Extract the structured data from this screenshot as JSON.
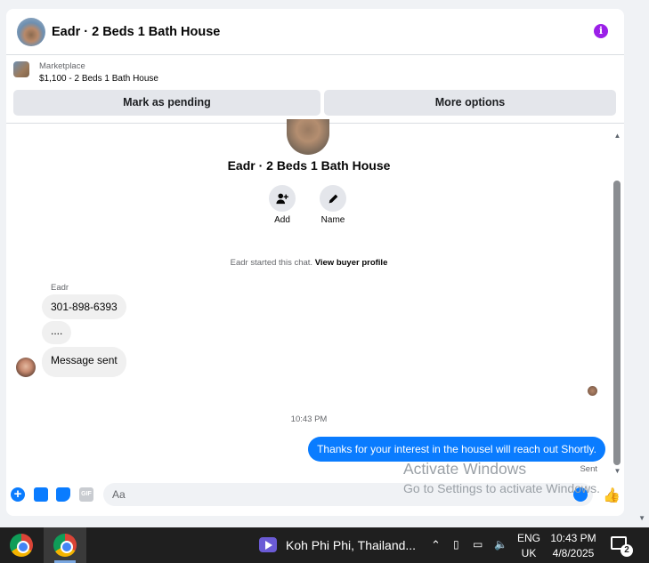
{
  "header": {
    "title": "Eadr · 2 Beds 1 Bath House",
    "info_icon_glyph": "i",
    "accent_color": "#9b1fe8"
  },
  "marketplace": {
    "label": "Marketplace",
    "listing": "$1,100 - 2 Beds 1 Bath House",
    "buttons": {
      "pending": "Mark as pending",
      "more": "More options"
    }
  },
  "chat": {
    "title": "Eadr · 2 Beds 1 Bath House",
    "actions": {
      "add": "Add",
      "name": "Name"
    },
    "started_text": "Eadr started this chat.",
    "view_profile": "View buyer profile",
    "sender_name": "Eadr",
    "messages_in": [
      "301-898-6393",
      "....",
      "Message sent"
    ],
    "timestamp": "10:43 PM",
    "message_out": "Thanks for your interest in the housel will reach out Shortly.",
    "sent_status": "Sent"
  },
  "composer": {
    "placeholder": "Aa",
    "gif_label": "GIF",
    "brand_color": "#0a7cff"
  },
  "watermark": {
    "line1": "Activate Windows",
    "line2": "Go to Settings to activate Windows."
  },
  "taskbar": {
    "media_title": "Koh Phi Phi, Thailand...",
    "lang_line1": "ENG",
    "lang_line2": "UK",
    "time": "10:43 PM",
    "date": "4/8/2025",
    "notification_count": "2"
  }
}
